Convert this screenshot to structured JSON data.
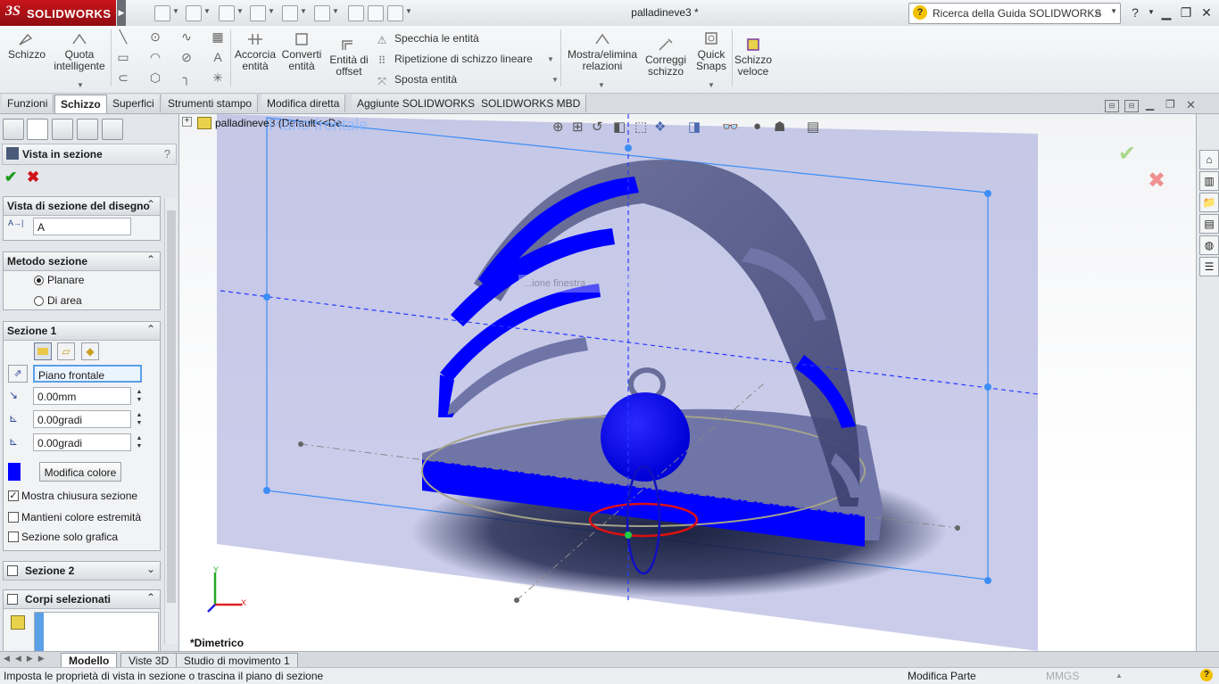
{
  "app": {
    "logo_prefix": "3S",
    "logo_text": "SOLIDWORKS",
    "document_title": "palladineve3 *"
  },
  "help_search": {
    "placeholder": "Ricerca della Guida SOLIDWORKS"
  },
  "ribbon": {
    "schizzo": "Schizzo",
    "quota_1": "Quota",
    "quota_2": "intelligente",
    "accorcia_1": "Accorcia",
    "accorcia_2": "entità",
    "converti_1": "Converti",
    "converti_2": "entità",
    "offset_1": "Entità di",
    "offset_2": "offset",
    "specchia": "Specchia le entità",
    "ripetizione": "Ripetizione di schizzo lineare",
    "sposta": "Sposta entità",
    "mostra_1": "Mostra/elimina",
    "mostra_2": "relazioni",
    "correggi_1": "Correggi",
    "correggi_2": "schizzo",
    "quick_1": "Quick",
    "quick_2": "Snaps",
    "veloce_1": "Schizzo",
    "veloce_2": "veloce"
  },
  "command_tabs": [
    "Funzioni",
    "Schizzo",
    "Superfici",
    "Strumenti stampo",
    "Modifica diretta",
    "Aggiunte SOLIDWORKS",
    "SOLIDWORKS MBD"
  ],
  "property_manager": {
    "title": "Vista in sezione",
    "help": "?",
    "group_drawing_section": {
      "title": "Vista di sezione del disegno",
      "value": "A"
    },
    "group_method": {
      "title": "Metodo sezione",
      "options": [
        "Planare",
        "Di area"
      ],
      "selected": "Planare"
    },
    "group_section1": {
      "title": "Sezione 1",
      "plane": "Piano frontale",
      "offset": "0.00mm",
      "angle_x": "0.00gradi",
      "angle_y": "0.00gradi",
      "color_button": "Modifica colore",
      "section_color": "#0000ff",
      "checks": [
        {
          "label": "Mostra chiusura sezione",
          "checked": true
        },
        {
          "label": "Mantieni colore estremità",
          "checked": false
        },
        {
          "label": "Sezione solo grafica",
          "checked": false
        }
      ]
    },
    "group_section2": {
      "title": "Sezione 2"
    },
    "group_bodies": {
      "title": "Corpi selezionati"
    }
  },
  "viewport": {
    "tree_label": "palladineve3  (Default<<De...",
    "plane_label": "Piano frontale",
    "ghost_text": "...ione finestra",
    "view_name": "*Dimetrico",
    "triad": {
      "x": "X",
      "y": "Y"
    }
  },
  "bottom_tabs": [
    "Modello",
    "Viste 3D",
    "Studio di movimento 1"
  ],
  "status": {
    "message": "Imposta le proprietà di vista in sezione o trascina il piano di sezione",
    "mode": "Modifica Parte",
    "units": "MMGS"
  },
  "colors": {
    "accent_red": "#c8141b",
    "section_blue": "#0000ff",
    "plane_blue": "#3d8df5"
  }
}
